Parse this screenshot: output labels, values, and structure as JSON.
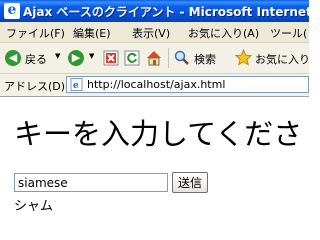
{
  "window": {
    "title": "Ajax ベースのクライアント - Microsoft Internet Expl",
    "icon": "internet-explorer-icon"
  },
  "menu": {
    "items": [
      "ファイル(F)",
      "編集(E)",
      "表示(V)",
      "お気に入り(A)",
      "ツール("
    ]
  },
  "toolbar": {
    "back_label": "戻る",
    "search_label": "検索",
    "favorites_label": "お気に入り"
  },
  "address": {
    "label": "アドレス(D)",
    "url": "http://localhost/ajax.html"
  },
  "page": {
    "heading": "キーを入力してくださ",
    "input_value": "siamese",
    "button_label": "送信",
    "result": "シャム"
  },
  "colors": {
    "titlebar": "#0a5ee8",
    "back_button": "#2e9a2e",
    "stop_button": "#d63a2a",
    "refresh_button": "#2f8f2f"
  }
}
